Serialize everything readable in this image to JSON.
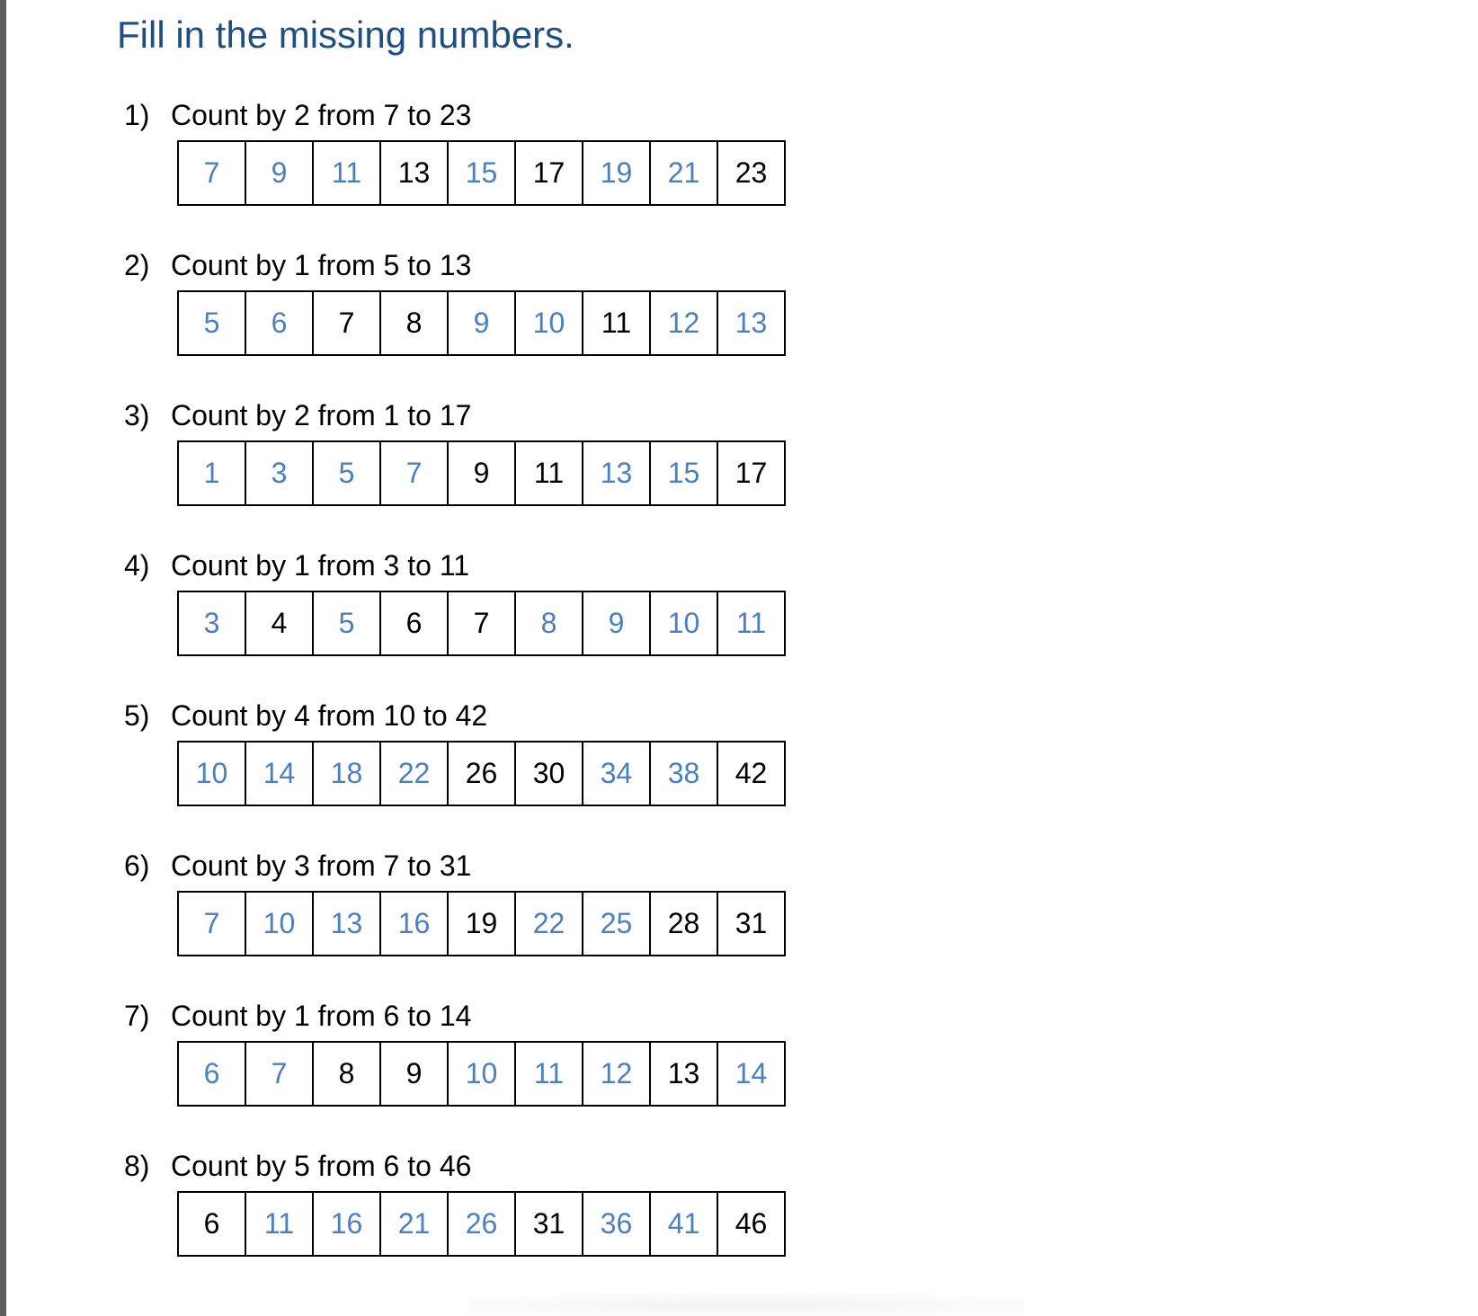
{
  "title": "Fill in the missing numbers.",
  "colors": {
    "title": "#1f4f82",
    "answer": "#4a7fc1",
    "given": "#000000"
  },
  "problems": [
    {
      "number": "1)",
      "prompt": "Count by 2 from 7 to 23",
      "cells": [
        {
          "value": "7",
          "kind": "answer"
        },
        {
          "value": "9",
          "kind": "answer"
        },
        {
          "value": "11",
          "kind": "answer"
        },
        {
          "value": "13",
          "kind": "given"
        },
        {
          "value": "15",
          "kind": "answer"
        },
        {
          "value": "17",
          "kind": "given"
        },
        {
          "value": "19",
          "kind": "answer"
        },
        {
          "value": "21",
          "kind": "answer"
        },
        {
          "value": "23",
          "kind": "given"
        }
      ]
    },
    {
      "number": "2)",
      "prompt": "Count by 1 from 5 to 13",
      "cells": [
        {
          "value": "5",
          "kind": "answer"
        },
        {
          "value": "6",
          "kind": "answer"
        },
        {
          "value": "7",
          "kind": "given"
        },
        {
          "value": "8",
          "kind": "given"
        },
        {
          "value": "9",
          "kind": "answer"
        },
        {
          "value": "10",
          "kind": "answer"
        },
        {
          "value": "11",
          "kind": "given"
        },
        {
          "value": "12",
          "kind": "answer"
        },
        {
          "value": "13",
          "kind": "answer"
        }
      ]
    },
    {
      "number": "3)",
      "prompt": "Count by 2 from 1 to 17",
      "cells": [
        {
          "value": "1",
          "kind": "answer"
        },
        {
          "value": "3",
          "kind": "answer"
        },
        {
          "value": "5",
          "kind": "answer"
        },
        {
          "value": "7",
          "kind": "answer"
        },
        {
          "value": "9",
          "kind": "given"
        },
        {
          "value": "11",
          "kind": "given"
        },
        {
          "value": "13",
          "kind": "answer"
        },
        {
          "value": "15",
          "kind": "answer"
        },
        {
          "value": "17",
          "kind": "given"
        }
      ]
    },
    {
      "number": "4)",
      "prompt": "Count by 1 from 3 to 11",
      "cells": [
        {
          "value": "3",
          "kind": "answer"
        },
        {
          "value": "4",
          "kind": "given"
        },
        {
          "value": "5",
          "kind": "answer"
        },
        {
          "value": "6",
          "kind": "given"
        },
        {
          "value": "7",
          "kind": "given"
        },
        {
          "value": "8",
          "kind": "answer"
        },
        {
          "value": "9",
          "kind": "answer"
        },
        {
          "value": "10",
          "kind": "answer"
        },
        {
          "value": "11",
          "kind": "answer"
        }
      ]
    },
    {
      "number": "5)",
      "prompt": "Count by 4 from 10 to 42",
      "cells": [
        {
          "value": "10",
          "kind": "answer"
        },
        {
          "value": "14",
          "kind": "answer"
        },
        {
          "value": "18",
          "kind": "answer"
        },
        {
          "value": "22",
          "kind": "answer"
        },
        {
          "value": "26",
          "kind": "given"
        },
        {
          "value": "30",
          "kind": "given"
        },
        {
          "value": "34",
          "kind": "answer"
        },
        {
          "value": "38",
          "kind": "answer"
        },
        {
          "value": "42",
          "kind": "given"
        }
      ]
    },
    {
      "number": "6)",
      "prompt": "Count by 3 from 7 to 31",
      "cells": [
        {
          "value": "7",
          "kind": "answer"
        },
        {
          "value": "10",
          "kind": "answer"
        },
        {
          "value": "13",
          "kind": "answer"
        },
        {
          "value": "16",
          "kind": "answer"
        },
        {
          "value": "19",
          "kind": "given"
        },
        {
          "value": "22",
          "kind": "answer"
        },
        {
          "value": "25",
          "kind": "answer"
        },
        {
          "value": "28",
          "kind": "given"
        },
        {
          "value": "31",
          "kind": "given"
        }
      ]
    },
    {
      "number": "7)",
      "prompt": "Count by 1 from 6 to 14",
      "cells": [
        {
          "value": "6",
          "kind": "answer"
        },
        {
          "value": "7",
          "kind": "answer"
        },
        {
          "value": "8",
          "kind": "given"
        },
        {
          "value": "9",
          "kind": "given"
        },
        {
          "value": "10",
          "kind": "answer"
        },
        {
          "value": "11",
          "kind": "answer"
        },
        {
          "value": "12",
          "kind": "answer"
        },
        {
          "value": "13",
          "kind": "given"
        },
        {
          "value": "14",
          "kind": "answer"
        }
      ]
    },
    {
      "number": "8)",
      "prompt": "Count by 5 from 6 to 46",
      "cells": [
        {
          "value": "6",
          "kind": "given"
        },
        {
          "value": "11",
          "kind": "answer"
        },
        {
          "value": "16",
          "kind": "answer"
        },
        {
          "value": "21",
          "kind": "answer"
        },
        {
          "value": "26",
          "kind": "answer"
        },
        {
          "value": "31",
          "kind": "given"
        },
        {
          "value": "36",
          "kind": "answer"
        },
        {
          "value": "41",
          "kind": "answer"
        },
        {
          "value": "46",
          "kind": "given"
        }
      ]
    }
  ]
}
